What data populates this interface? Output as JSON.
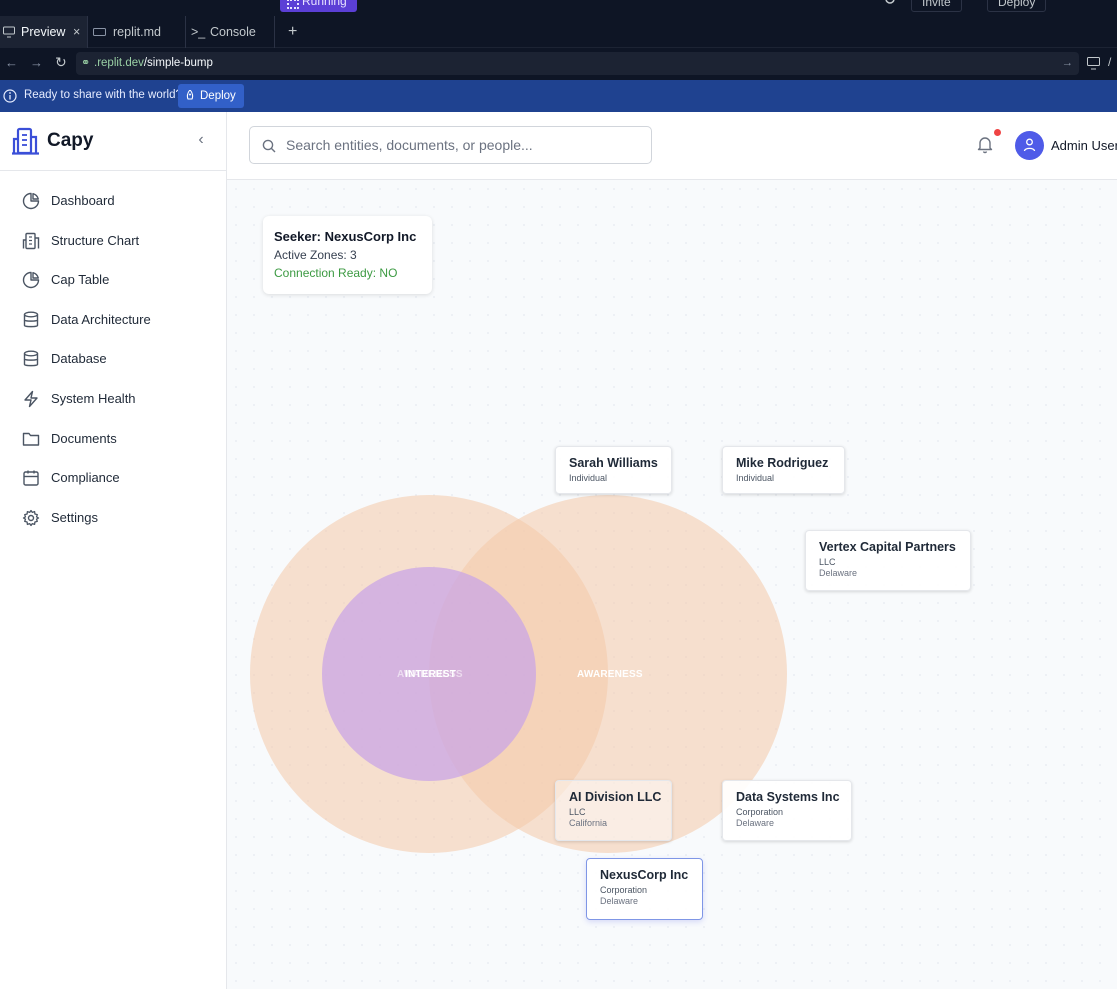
{
  "ide": {
    "run_status": "Running",
    "invite_label": "Invite",
    "deploy_top_label": "Deploy",
    "tabs": [
      {
        "label": "Preview"
      },
      {
        "label": "replit.md"
      },
      {
        "label": "Console"
      }
    ],
    "url_domain": ".replit.dev",
    "url_path": "/simple-bump",
    "share_text": "Ready to share with the world?",
    "share_deploy_label": "Deploy"
  },
  "sidebar": {
    "brand": "Capy",
    "items": [
      {
        "label": "Dashboard",
        "icon": "pie-chart-icon"
      },
      {
        "label": "Structure Chart",
        "icon": "building-icon"
      },
      {
        "label": "Cap Table",
        "icon": "pie-chart-icon"
      },
      {
        "label": "Data Architecture",
        "icon": "database-icon"
      },
      {
        "label": "Database",
        "icon": "database-icon"
      },
      {
        "label": "System Health",
        "icon": "lightning-icon"
      },
      {
        "label": "Documents",
        "icon": "folder-icon"
      },
      {
        "label": "Compliance",
        "icon": "calendar-icon"
      },
      {
        "label": "Settings",
        "icon": "gear-icon"
      }
    ]
  },
  "header": {
    "search_placeholder": "Search entities, documents, or people...",
    "user_name": "Admin User"
  },
  "seeker": {
    "title": "Seeker: NexusCorp Inc",
    "zones": "Active Zones: 3",
    "connection": "Connection Ready: NO"
  },
  "zones": {
    "outer_left_label": "AWARENESS",
    "interest_label": "INTEREST",
    "outer_right_label": "AWARENESS"
  },
  "colors": {
    "awareness_fill": "#f4c9a8",
    "interest_fill": "#c9a6e6",
    "selected_border": "#7f96e6",
    "connection_green": "#3c9a42",
    "share_bar": "#1f4290"
  },
  "nodes": [
    {
      "name": "Sarah Williams",
      "type": "Individual",
      "state": ""
    },
    {
      "name": "Mike Rodriguez",
      "type": "Individual",
      "state": ""
    },
    {
      "name": "Vertex Capital Partners",
      "type": "LLC",
      "state": "Delaware"
    },
    {
      "name": "AI Division LLC",
      "type": "LLC",
      "state": "California"
    },
    {
      "name": "Data Systems Inc",
      "type": "Corporation",
      "state": "Delaware"
    },
    {
      "name": "NexusCorp Inc",
      "type": "Corporation",
      "state": "Delaware"
    }
  ]
}
